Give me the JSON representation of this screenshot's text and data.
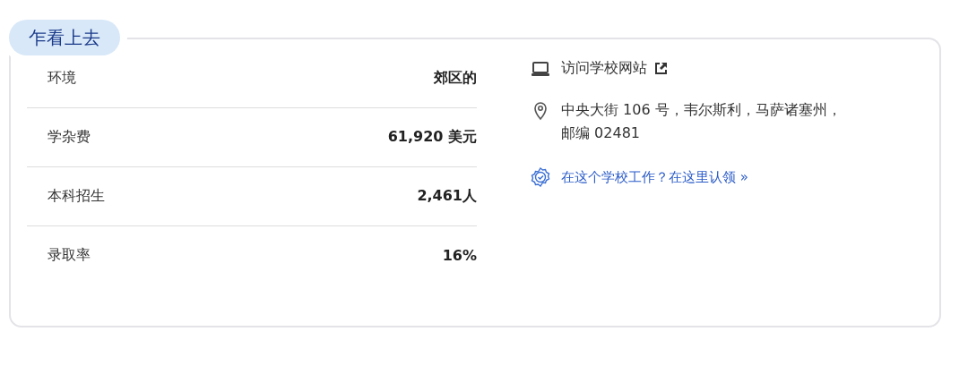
{
  "section_tag": "乍看上去",
  "facts": [
    {
      "label": "环境",
      "value": "郊区的"
    },
    {
      "label": "学杂费",
      "value": "61,920 美元"
    },
    {
      "label": "本科招生",
      "value": "2,461人"
    },
    {
      "label": "录取率",
      "value": "16%"
    }
  ],
  "website_link": "访问学校网站",
  "address": "中央大街 106 号，韦尔斯利，马萨诸塞州，邮编 02481",
  "claim_link": "在这个学校工作？在这里认领 »"
}
